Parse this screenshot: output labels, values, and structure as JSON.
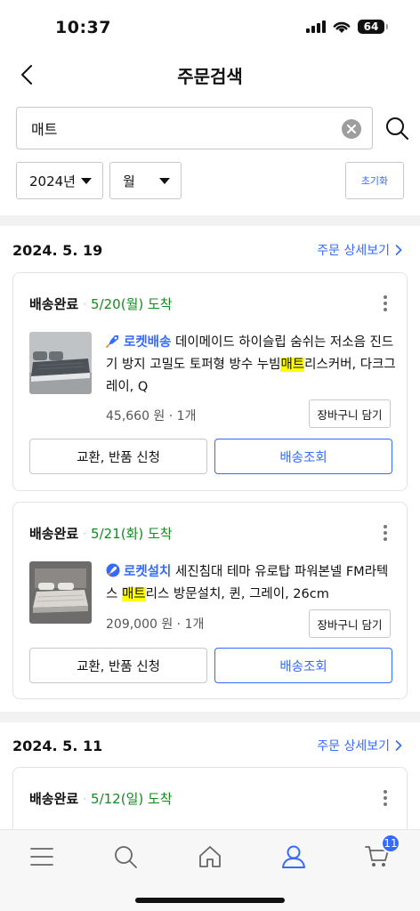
{
  "status_bar": {
    "time": "10:37",
    "battery": "64"
  },
  "nav": {
    "title": "주문검색"
  },
  "search": {
    "value": "매트"
  },
  "filters": {
    "year": "2024년",
    "month": "월",
    "reset_label": "초기화"
  },
  "detail_link_label": "주문 상세보기",
  "groups": [
    {
      "date": "2024. 5. 19",
      "orders": [
        {
          "status": "배송완료",
          "delivery": "5/20(월) 도착",
          "badge": "로켓배송",
          "title_before": "데이메이드 하이슬립 숨쉬는 저소음 진드기 방지 고밀도 토퍼형 방수 누빔",
          "title_highlight": "매트",
          "title_after": "리스커버, 다크그레이, Q",
          "price": "45,660 원 · 1개",
          "cart_label": "장바구니 담기",
          "exchange_label": "교환, 반품 신청",
          "track_label": "배송조회"
        },
        {
          "status": "배송완료",
          "delivery": "5/21(화) 도착",
          "badge": "로켓설치",
          "title_before": "세진침대 테마 유로탑 파워본넬 FM라텍스 ",
          "title_highlight": "매트",
          "title_after": "리스 방문설치, 퀸, 그레이, 26cm",
          "price": "209,000 원 · 1개",
          "cart_label": "장바구니 담기",
          "exchange_label": "교환, 반품 신청",
          "track_label": "배송조회"
        }
      ]
    },
    {
      "date": "2024. 5. 11",
      "orders": [
        {
          "status": "배송완료",
          "delivery": "5/12(일) 도착"
        }
      ]
    }
  ],
  "tabbar": {
    "cart_count": "11"
  },
  "colors": {
    "accent": "#346aff",
    "delivered_green": "#138a1e",
    "highlight": "#ffff00"
  }
}
